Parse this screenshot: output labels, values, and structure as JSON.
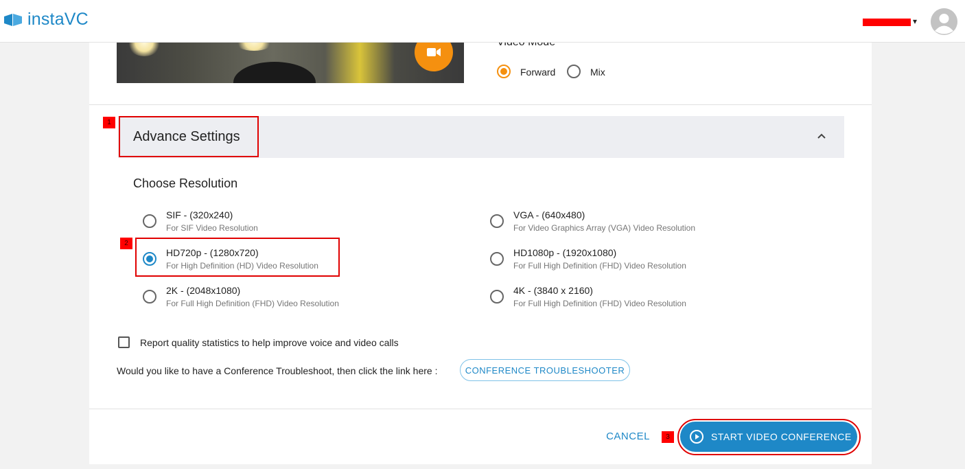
{
  "app": {
    "name": "instaVC"
  },
  "header": {
    "user_menu_caret": "▾",
    "avatar_icon": "user-avatar-icon"
  },
  "video_mode": {
    "label": "Video Mode",
    "options": [
      {
        "label": "Forward",
        "selected": true
      },
      {
        "label": "Mix",
        "selected": false
      }
    ]
  },
  "advance_settings": {
    "title": "Advance Settings",
    "expanded": true
  },
  "resolution": {
    "title": "Choose Resolution",
    "options": [
      {
        "label": "SIF - (320x240)",
        "description": "For SIF Video Resolution",
        "selected": false
      },
      {
        "label": "VGA - (640x480)",
        "description": "For Video Graphics Array (VGA) Video Resolution",
        "selected": false
      },
      {
        "label": "HD720p - (1280x720)",
        "description": "For High Definition (HD) Video Resolution",
        "selected": true
      },
      {
        "label": "HD1080p - (1920x1080)",
        "description": "For Full High Definition (FHD) Video Resolution",
        "selected": false
      },
      {
        "label": "2K - (2048x1080)",
        "description": "For Full High Definition (FHD) Video Resolution",
        "selected": false
      },
      {
        "label": "4K - (3840 x 2160)",
        "description": "For Full High Definition (FHD) Video Resolution",
        "selected": false
      }
    ]
  },
  "quality_stats": {
    "label": "Report quality statistics to help improve voice and video calls",
    "checked": false
  },
  "troubleshoot": {
    "prompt": "Would you like to have a Conference Troubleshoot, then click the link here :",
    "button_label": "CONFERENCE TROUBLESHOOTER"
  },
  "actions": {
    "cancel_label": "CANCEL",
    "start_label": "START VIDEO CONFERENCE"
  },
  "annotations": [
    "1",
    "2",
    "3"
  ],
  "colors": {
    "accent": "#1e88c7",
    "camera": "#f5900f",
    "annotation": "#ff0000"
  }
}
